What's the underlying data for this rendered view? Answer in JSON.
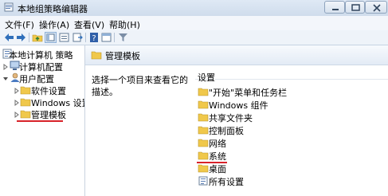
{
  "window": {
    "title": "本地组策略编辑器"
  },
  "menu": {
    "items": [
      {
        "label": "文件(F)"
      },
      {
        "label": "操作(A)"
      },
      {
        "label": "查看(V)"
      },
      {
        "label": "帮助(H)"
      }
    ]
  },
  "toolbar": {
    "buttons": [
      "back-arrow-icon",
      "forward-arrow-icon",
      "up-folder-icon",
      "show-hide-tree-icon",
      "properties-icon",
      "help-icon",
      "extended-view-icon",
      "filter-icon"
    ]
  },
  "tree": {
    "root": "本地计算机 策略",
    "computer_config": "计算机配置",
    "user_config": "用户配置",
    "software_settings": "软件设置",
    "windows_settings": "Windows 设置",
    "admin_templates": "管理模板"
  },
  "content": {
    "header_title": "管理模板",
    "description": "选择一个项目来查看它的描述。",
    "list_header": "设置",
    "items": [
      {
        "label": "\"开始\"菜单和任务栏"
      },
      {
        "label": "Windows 组件"
      },
      {
        "label": "共享文件夹"
      },
      {
        "label": "控制面板"
      },
      {
        "label": "网络"
      },
      {
        "label": "系统"
      },
      {
        "label": "桌面"
      },
      {
        "label": "所有设置"
      }
    ]
  },
  "colors": {
    "highlight_underline": "#d8232a",
    "folder": "#f0c84b",
    "title_bar": "#dfe9f5"
  }
}
